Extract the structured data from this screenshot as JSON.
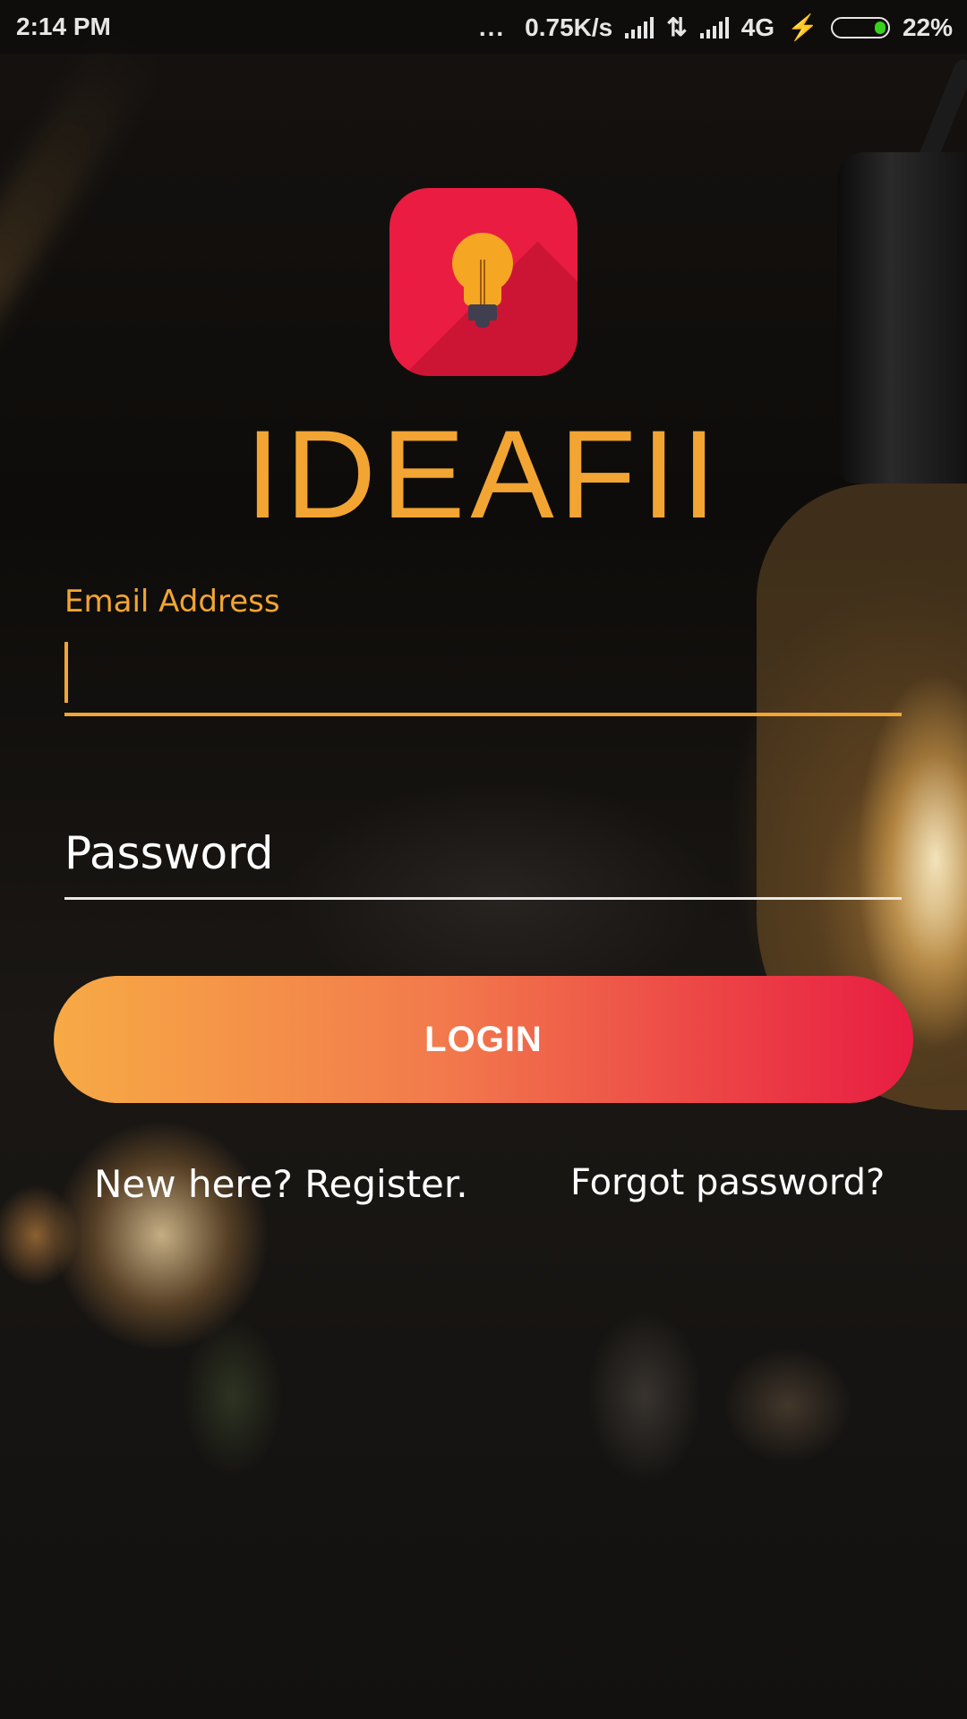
{
  "status_bar": {
    "time": "2:14 PM",
    "more": "...",
    "network_speed": "0.75K/s",
    "network_type": "4G",
    "battery_percent": "22%",
    "battery_level": 0.22,
    "battery_color": "#35d31b"
  },
  "app": {
    "name": "IDEAFII",
    "icon": "lightbulb-icon",
    "brand_color": "#ea1c41",
    "accent_color": "#f2a533"
  },
  "form": {
    "email_label": "Email Address",
    "email_value": "",
    "password_placeholder": "Password"
  },
  "actions": {
    "login_label": "LOGIN",
    "register_label": "New here? Register.",
    "forgot_label": "Forgot password?"
  }
}
